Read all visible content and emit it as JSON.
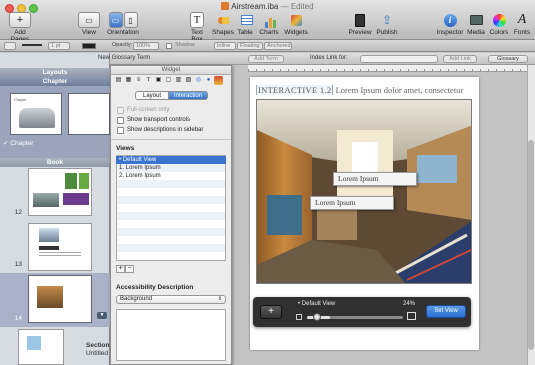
{
  "window": {
    "title": "Airstream.iba",
    "status": "Edited"
  },
  "toolbar": {
    "add_pages": "Add Pages",
    "view": "View",
    "orientation": "Orientation",
    "text_box": "Text Box",
    "shapes": "Shapes",
    "table": "Table",
    "charts": "Charts",
    "widgets": "Widgets",
    "preview": "Preview",
    "publish": "Publish",
    "inspector": "Inspector",
    "media": "Media",
    "colors": "Colors",
    "fonts": "Fonts"
  },
  "format_bar": {
    "stroke_width": "1 pt",
    "opacity_label": "Opacity:",
    "opacity_value": "100%",
    "shadow_label": "Shadow",
    "inline": "Inline",
    "floating": "Floating",
    "anchored": "Anchored"
  },
  "glossary_bar": {
    "new_term": "New Glossary Term",
    "add_term": "Add Term",
    "index_link_for": "Index Link for:",
    "add_link": "Add Link",
    "glossary": "Glossary"
  },
  "left_panel": {
    "layouts_header": "Layouts",
    "chapter_header": "Chapter",
    "chapter_thumb_label": "Chapter",
    "book_header": "Book",
    "pages": [
      "12",
      "13",
      "14"
    ],
    "section_label": "Section",
    "section_sub": "Untitled"
  },
  "inspector": {
    "title": "Widget",
    "tabs": [
      "Layout",
      "Interaction"
    ],
    "fullscreen_only": "Full-screen only",
    "show_transport": "Show transport controls",
    "show_descriptions": "Show descriptions in sidebar",
    "views_label": "Views",
    "views": [
      "• Default View",
      "1. Lorem Ipsum",
      "2. Lorem Ipsum"
    ],
    "add": "+",
    "remove": "−",
    "accessibility_label": "Accessibility Description",
    "accessibility_value": "Background"
  },
  "canvas": {
    "widget_label": "INTERACTIVE 1.2",
    "widget_caption": "Lorem Ipsum dolor amet, consectetur",
    "callouts": [
      "Lorem Ipsum",
      "Lorem Ipsum"
    ]
  },
  "hud": {
    "add": "+",
    "view_name": "• Default View",
    "zoom_percent": "24%",
    "zoom_fraction": 0.24,
    "set_view": "Set View"
  }
}
